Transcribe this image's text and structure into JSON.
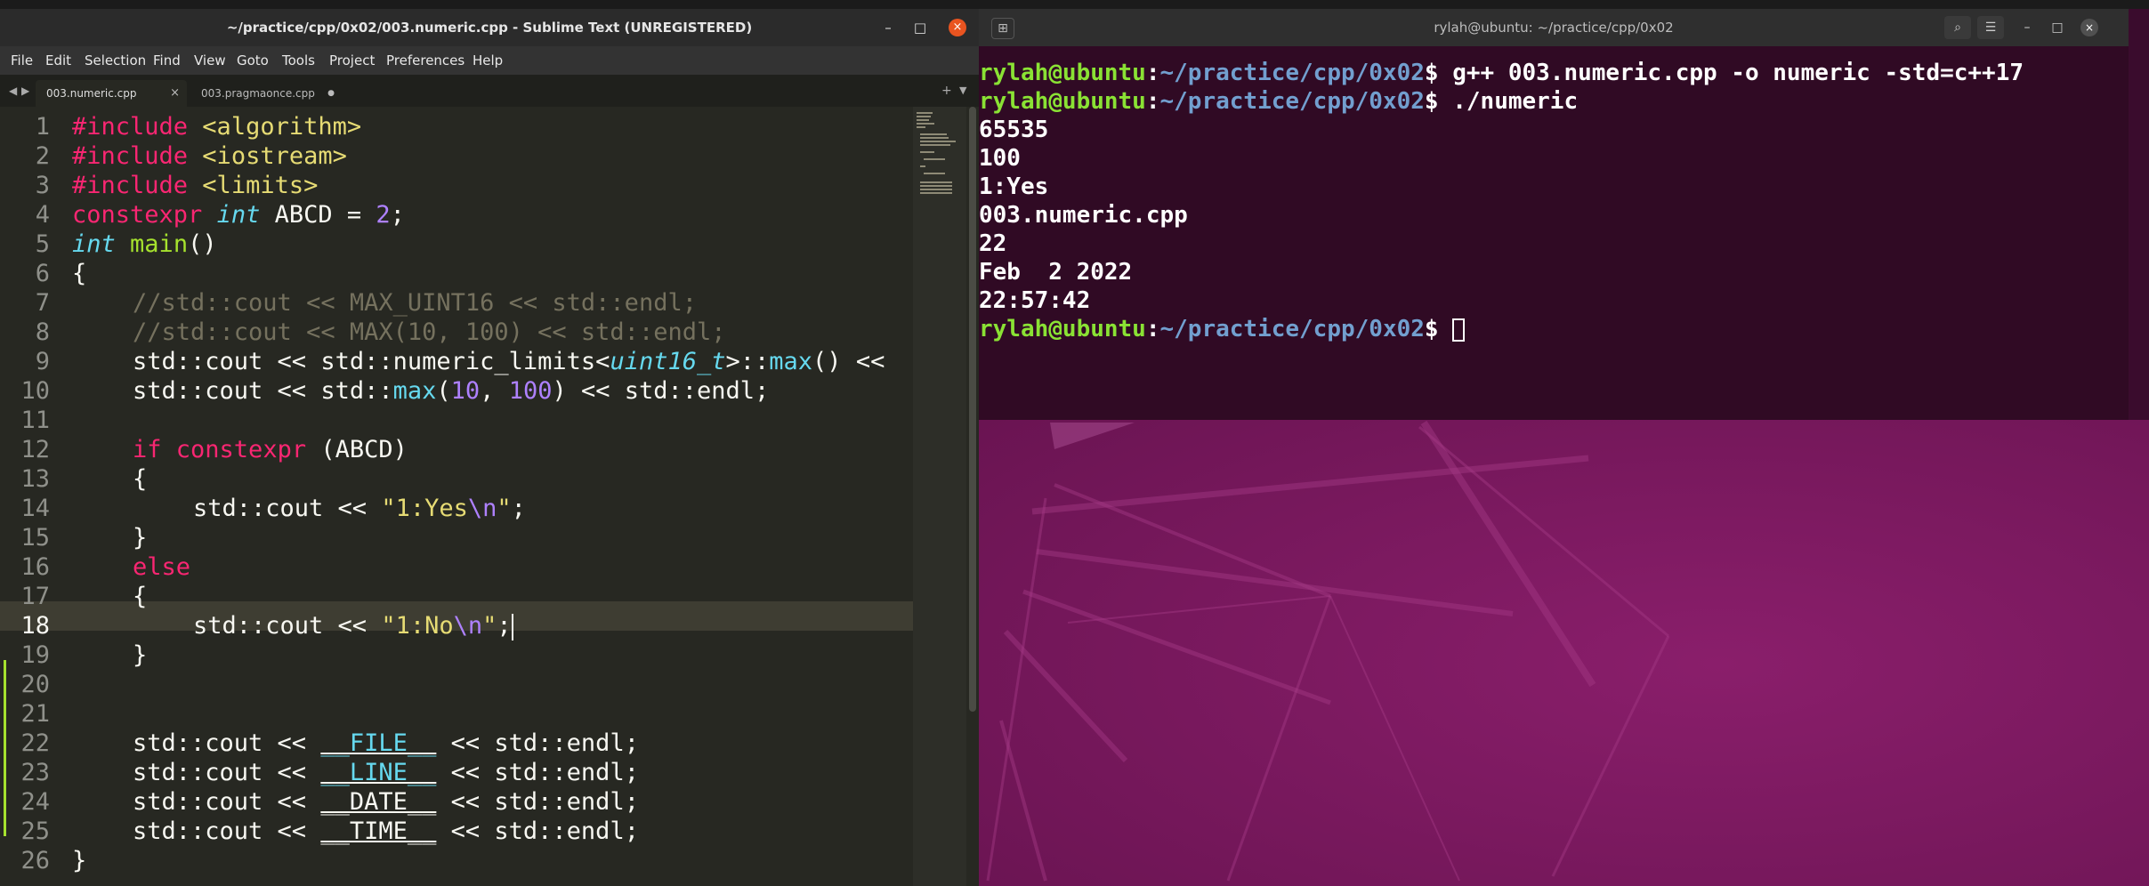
{
  "sublime": {
    "title": "~/practice/cpp/0x02/003.numeric.cpp - Sublime Text (UNREGISTERED)",
    "window_controls": {
      "minimize": "–",
      "maximize": "□",
      "close": "×"
    },
    "menu": [
      "File",
      "Edit",
      "Selection",
      "Find",
      "View",
      "Goto",
      "Tools",
      "Project",
      "Preferences",
      "Help"
    ],
    "tabs": [
      {
        "label": "003.numeric.cpp",
        "close": "×"
      },
      {
        "label": "003.pragmaonce.cpp",
        "close": "●"
      }
    ],
    "tab_nav": {
      "left": "◀",
      "right": "▶",
      "new": "+",
      "menu": "▼"
    },
    "line_numbers": [
      "1",
      "2",
      "3",
      "4",
      "5",
      "6",
      "7",
      "8",
      "9",
      "10",
      "11",
      "12",
      "13",
      "14",
      "15",
      "16",
      "17",
      "18",
      "19",
      "20",
      "21",
      "22",
      "23",
      "24",
      "25",
      "26"
    ],
    "active_line": "18",
    "code": {
      "l1": {
        "a": "#include",
        "b": " <algorithm>"
      },
      "l2": {
        "a": "#include",
        "b": " <iostream>"
      },
      "l3": {
        "a": "#include",
        "b": " <limits>"
      },
      "l4": {
        "a": "constexpr",
        "b": "int",
        "c": " ABCD = ",
        "d": "2",
        "e": ";"
      },
      "l5": {
        "a": "int",
        "b": "main",
        "c": "()"
      },
      "l6": "{",
      "l7": "//std::cout << MAX_UINT16 << std::endl;",
      "l8": "//std::cout << MAX(10, 100) << std::endl;",
      "l9": {
        "a": "std::cout << std::numeric_limits<",
        "b": "uint16_t",
        "c": ">::",
        "d": "max",
        "e": "() <<"
      },
      "l10": {
        "a": "std::cout << std::",
        "b": "max",
        "c": "(",
        "d": "10",
        "e": ", ",
        "f": "100",
        "g": ") << std::endl;"
      },
      "l12": {
        "a": "if",
        "b": "constexpr",
        "c": " (ABCD)"
      },
      "l13": "{",
      "l14": {
        "a": "std::cout << ",
        "b": "\"1:Yes",
        "c": "\\n",
        "d": "\"",
        "e": ";"
      },
      "l15": "}",
      "l16": "else",
      "l17": "{",
      "l18": {
        "a": "std::cout << ",
        "b": "\"1:No",
        "c": "\\n",
        "d": "\"",
        "e": ";"
      },
      "l19": "}",
      "l21": {
        "a": "std::cout << ",
        "b": "__FILE__",
        "c": " << std::endl;"
      },
      "l22": {
        "a": "std::cout << ",
        "b": "__LINE__",
        "c": " << std::endl;"
      },
      "l23": {
        "a": "std::cout << ",
        "b": "__DATE__",
        "c": " << std::endl;"
      },
      "l24": {
        "a": "std::cout << ",
        "b": "__TIME__",
        "c": " << std::endl;"
      },
      "l26": "}"
    }
  },
  "terminal": {
    "title": "rylah@ubuntu: ~/practice/cpp/0x02",
    "new_tab_icon": "⊞",
    "search_icon": "⌕",
    "menu_icon": "☰",
    "window_controls": {
      "minimize": "–",
      "maximize": "□",
      "close": "×"
    },
    "prompt_user": "rylah@ubuntu",
    "prompt_sep": ":",
    "prompt_path": "~/practice/cpp/0x02",
    "prompt_dollar": "$ ",
    "commands": [
      "g++ 003.numeric.cpp -o numeric -std=c++17",
      "./numeric"
    ],
    "output": [
      "65535",
      "100",
      "1:Yes",
      "003.numeric.cpp",
      "22",
      "Feb  2 2022",
      "22:57:42"
    ]
  },
  "colors": {
    "editor_bg": "#272822",
    "terminal_bg": "#300a24",
    "desktop_accent": "#8a1e6b",
    "close_button": "#e95420"
  }
}
